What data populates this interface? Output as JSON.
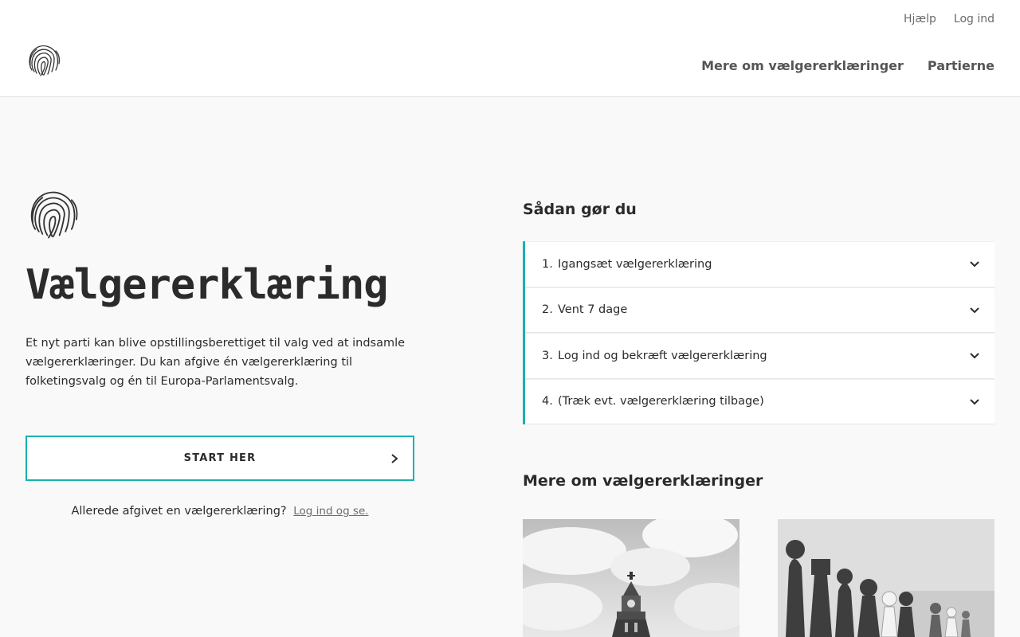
{
  "util_nav": {
    "help": "Hjælp",
    "login": "Log ind"
  },
  "main_nav": {
    "more": "Mere om vælgererklæringer",
    "parties": "Partierne"
  },
  "hero": {
    "title": "Vælgererklæring",
    "intro": "Et nyt parti kan blive opstillingsberettiget til valg ved at indsamle vælgererklæringer. Du kan afgive én vælgererklæring til folketingsvalg og én til Europa-Parlamentsvalg.",
    "start_label": "START HER",
    "already_text": "Allerede afgivet en vælgererklæring?",
    "already_link": "Log ind og se."
  },
  "steps": {
    "title": "Sådan gør du",
    "items": [
      {
        "num": "1.",
        "label": "Igangsæt vælgererklæring"
      },
      {
        "num": "2.",
        "label": "Vent 7 dage"
      },
      {
        "num": "3.",
        "label": "Log ind og bekræft vælgererklæring"
      },
      {
        "num": "4.",
        "label": "(Træk evt. vælgererklæring tilbage)"
      }
    ]
  },
  "more": {
    "title": "Mere om vælgererklæringer"
  },
  "colors": {
    "accent": "#17b3b0",
    "text": "#2b2b2b",
    "background": "#f9f9f9"
  }
}
